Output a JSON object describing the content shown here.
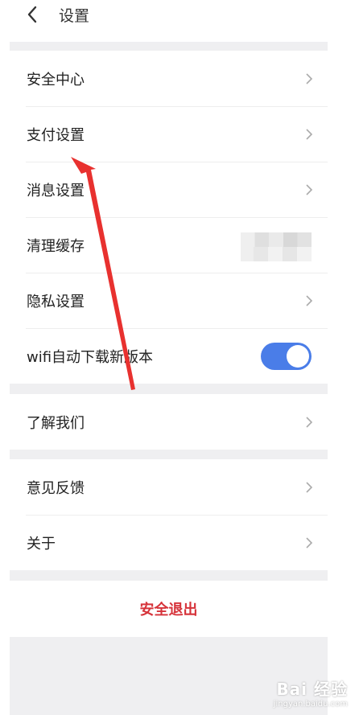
{
  "header": {
    "title": "设置"
  },
  "groups": {
    "main": {
      "items": [
        {
          "label": "安全中心"
        },
        {
          "label": "支付设置"
        },
        {
          "label": "消息设置"
        },
        {
          "label": "清理缓存"
        },
        {
          "label": "隐私设置"
        },
        {
          "label": "wifi自动下载新版本",
          "toggle_on": true
        }
      ]
    },
    "about_us": {
      "items": [
        {
          "label": "了解我们"
        }
      ]
    },
    "feedback": {
      "items": [
        {
          "label": "意见反馈"
        },
        {
          "label": "关于"
        }
      ]
    }
  },
  "logout": {
    "label": "安全退出"
  },
  "watermark": {
    "brand": "Bai 经验",
    "url": "jingyan.baidu.com"
  },
  "colors": {
    "toggle_on": "#4a7de8",
    "logout_text": "#d6333a",
    "annotation_arrow": "#e8312f",
    "page_background": "#efeff1"
  },
  "icons": {
    "back": "chevron-left-icon",
    "row_arrow": "chevron-right-icon"
  }
}
